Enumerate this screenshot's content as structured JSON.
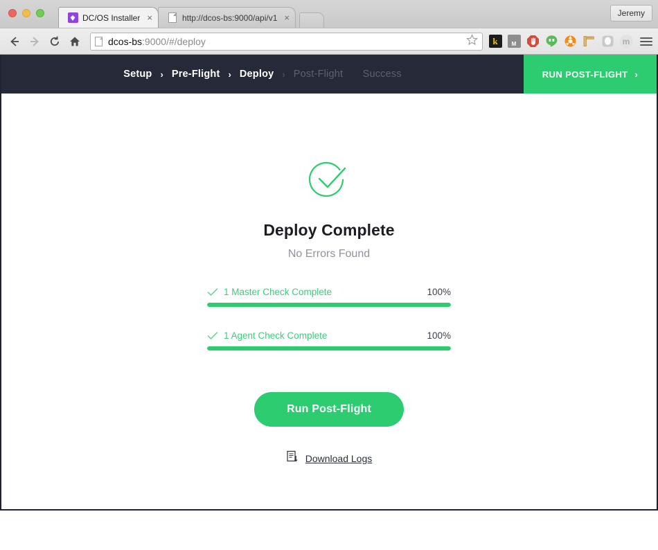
{
  "browser": {
    "profile_label": "Jeremy",
    "tabs": [
      {
        "title": "DC/OS Installer",
        "favicon": "dcos-logo-icon",
        "close": "×",
        "active": true
      },
      {
        "title": "http://dcos-bs:9000/api/v1",
        "favicon": "document-icon",
        "close": "×",
        "active": false
      }
    ],
    "address_bar": {
      "host": "dcos-bs",
      "path": ":9000/#/deploy",
      "full_url": "dcos-bs:9000/#/deploy"
    },
    "extensions": [
      {
        "name": "kraken-extension-icon",
        "glyph": "k"
      },
      {
        "name": "momentum-extension-icon",
        "glyph": "M"
      },
      {
        "name": "adblock-extension-icon",
        "glyph": ""
      },
      {
        "name": "hangouts-extension-icon",
        "glyph": ""
      },
      {
        "name": "clementine-extension-icon",
        "glyph": ""
      },
      {
        "name": "ruler-extension-icon",
        "glyph": ""
      },
      {
        "name": "ghost-extension-icon",
        "glyph": ""
      },
      {
        "name": "mega-extension-icon",
        "glyph": "m"
      }
    ]
  },
  "nav": {
    "steps": [
      {
        "label": "Setup",
        "state": "done"
      },
      {
        "label": "Pre-Flight",
        "state": "done"
      },
      {
        "label": "Deploy",
        "state": "active"
      },
      {
        "label": "Post-Flight",
        "state": "upcoming"
      },
      {
        "label": "Success",
        "state": "upcoming"
      }
    ],
    "separator": "›",
    "action": {
      "label": "RUN POST-FLIGHT",
      "chevron": "›",
      "color": "#2dcc70"
    }
  },
  "main": {
    "status_icon": "check-circle-icon",
    "title": "Deploy Complete",
    "subtitle": "No Errors Found",
    "checks": [
      {
        "label": "1 Master Check Complete",
        "percent_label": "100%",
        "percent": 100
      },
      {
        "label": "1 Agent Check Complete",
        "percent_label": "100%",
        "percent": 100
      }
    ],
    "cta_label": "Run Post-Flight",
    "download_label": "Download Logs",
    "download_icon": "document-download-icon"
  },
  "colors": {
    "accent_green": "#2dcc70",
    "nav_dark": "#262a38",
    "text_muted": "#8e939c"
  }
}
